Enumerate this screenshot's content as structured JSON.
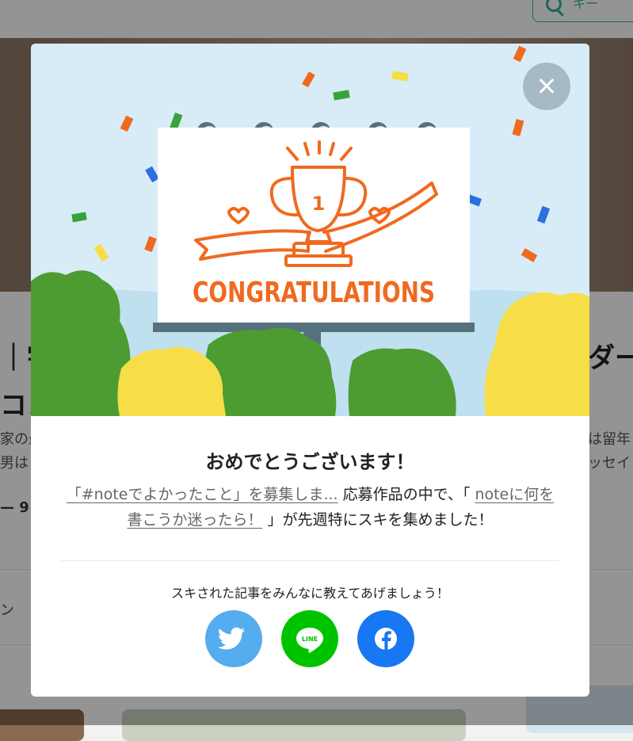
{
  "background": {
    "search_text": "キー",
    "title_left": "｜宇",
    "title_left_2": "コン",
    "title_right": "ダー",
    "text_left_1": "家の最",
    "text_left_2": "男はり",
    "text_right_1": "は留年",
    "text_right_2": "ッセイ",
    "meta_left": "— 9",
    "tag_left": "ン"
  },
  "modal": {
    "hero_text": "CONGRATULATIONS",
    "trophy_number": "1",
    "title": "おめでとうございます！",
    "link_1": "「#noteでよかったこと」を募集しま...",
    "text_middle": " 応募作品の中で、「 ",
    "link_2": "noteに何を書こうか迷ったら！",
    "text_end": " 」が先週特にスキを集めました！",
    "share_prompt": "スキされた記事をみんなに教えてあげましょう！",
    "line_label": "LINE"
  },
  "colors": {
    "twitter": "#55acee",
    "line": "#00c300",
    "facebook": "#1877f2",
    "accent_orange": "#ef6a1f",
    "sky": "#d7ecf7"
  },
  "icons": [
    "search-icon",
    "close-icon",
    "twitter-icon",
    "line-icon",
    "facebook-icon",
    "trophy-icon"
  ]
}
